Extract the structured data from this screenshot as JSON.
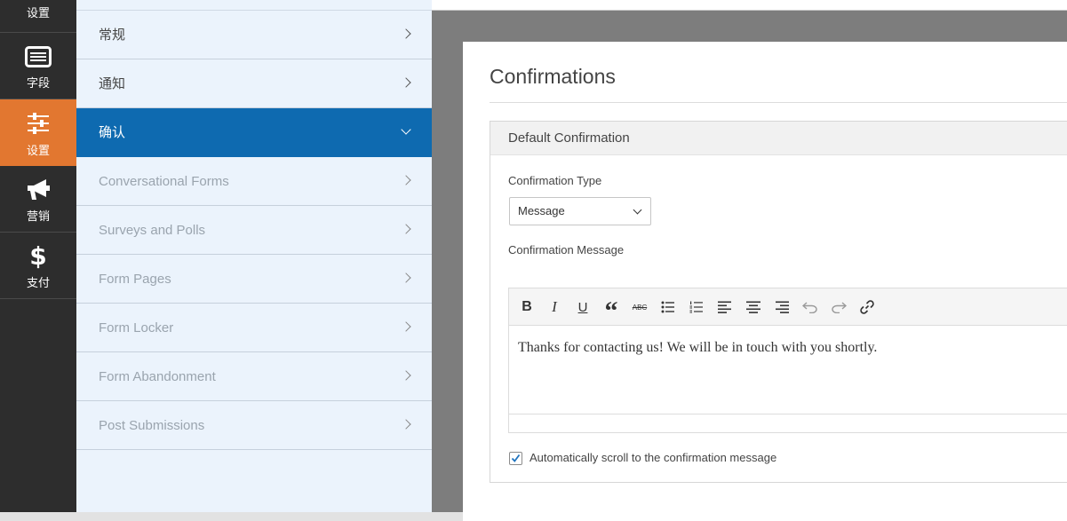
{
  "rail": {
    "items": [
      {
        "label": "设置",
        "icon": "settings-icon"
      },
      {
        "label": "字段",
        "icon": "fields-list-icon"
      },
      {
        "label": "设置",
        "icon": "sliders-icon",
        "active": true
      },
      {
        "label": "营销",
        "icon": "megaphone-icon"
      },
      {
        "label": "支付",
        "icon": "dollar-icon",
        "glyph": "$"
      }
    ],
    "active_color": "#e27730"
  },
  "settings_panel": {
    "items": [
      {
        "label": "常规"
      },
      {
        "label": "通知"
      },
      {
        "label": "确认",
        "active": true
      },
      {
        "label": "Conversational Forms"
      },
      {
        "label": "Surveys and Polls"
      },
      {
        "label": "Form Pages"
      },
      {
        "label": "Form Locker"
      },
      {
        "label": "Form Abandonment"
      },
      {
        "label": "Post Submissions"
      }
    ],
    "active_color": "#0e6ab0"
  },
  "confirmations": {
    "title": "Confirmations",
    "block_title": "Default Confirmation",
    "type_label": "Confirmation Type",
    "type_value": "Message",
    "message_label": "Confirmation Message",
    "toolbar": {
      "buttons": [
        "bold",
        "italic",
        "underline",
        "blockquote",
        "strikethrough",
        "bulleted-list",
        "numbered-list",
        "align-left",
        "align-center",
        "align-right",
        "undo",
        "redo",
        "link"
      ],
      "bold_glyph": "B",
      "italic_glyph": "I",
      "underline_glyph": "U",
      "quote_glyph": "“",
      "strike_glyph": "ABC"
    },
    "message_text": "Thanks for contacting us! We will be in touch with you shortly.",
    "auto_scroll_label": "Automatically scroll to the confirmation message",
    "auto_scroll_checked": true
  }
}
